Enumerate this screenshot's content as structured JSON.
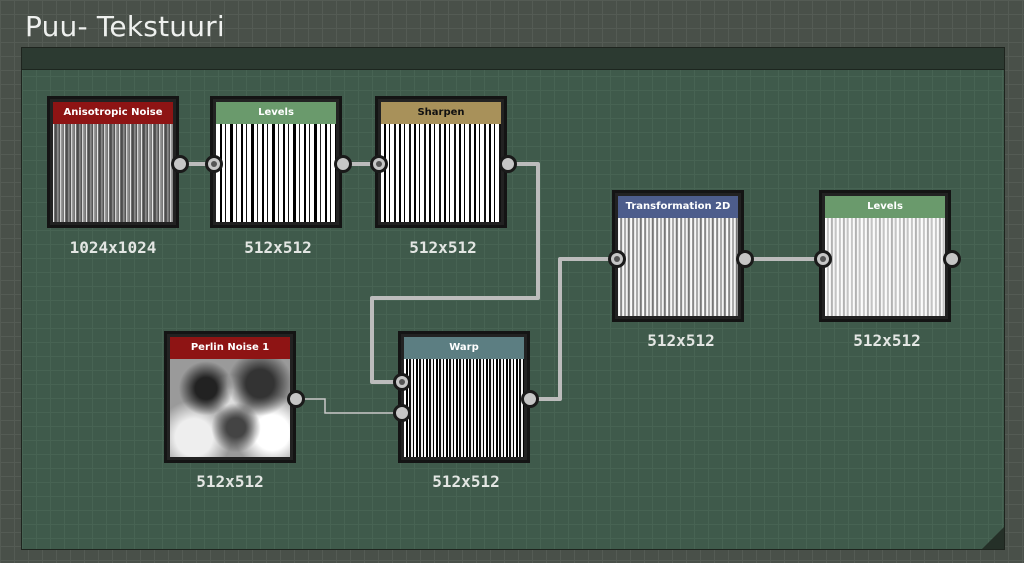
{
  "frame": {
    "title": "Puu- Tekstuuri"
  },
  "nodes": {
    "aniso": {
      "title": "Anisotropic Noise",
      "size": "1024x1024",
      "color": "#8e1414"
    },
    "levels1": {
      "title": "Levels",
      "size": "512x512",
      "color": "#6a9a6c"
    },
    "sharpen": {
      "title": "Sharpen",
      "size": "512x512",
      "color": "#a8915a"
    },
    "perlin": {
      "title": "Perlin Noise 1",
      "size": "512x512",
      "color": "#8e1414"
    },
    "warp": {
      "title": "Warp",
      "size": "512x512",
      "color": "#5c7e82"
    },
    "transform": {
      "title": "Transformation 2D",
      "size": "512x512",
      "color": "#4d5d8c"
    },
    "levels2": {
      "title": "Levels",
      "size": "512x512",
      "color": "#6a9a6c"
    }
  },
  "colors": {
    "frame_bg": "#3f5a4b",
    "canvas_bg": "#495049",
    "link": "#c8c8c8"
  }
}
